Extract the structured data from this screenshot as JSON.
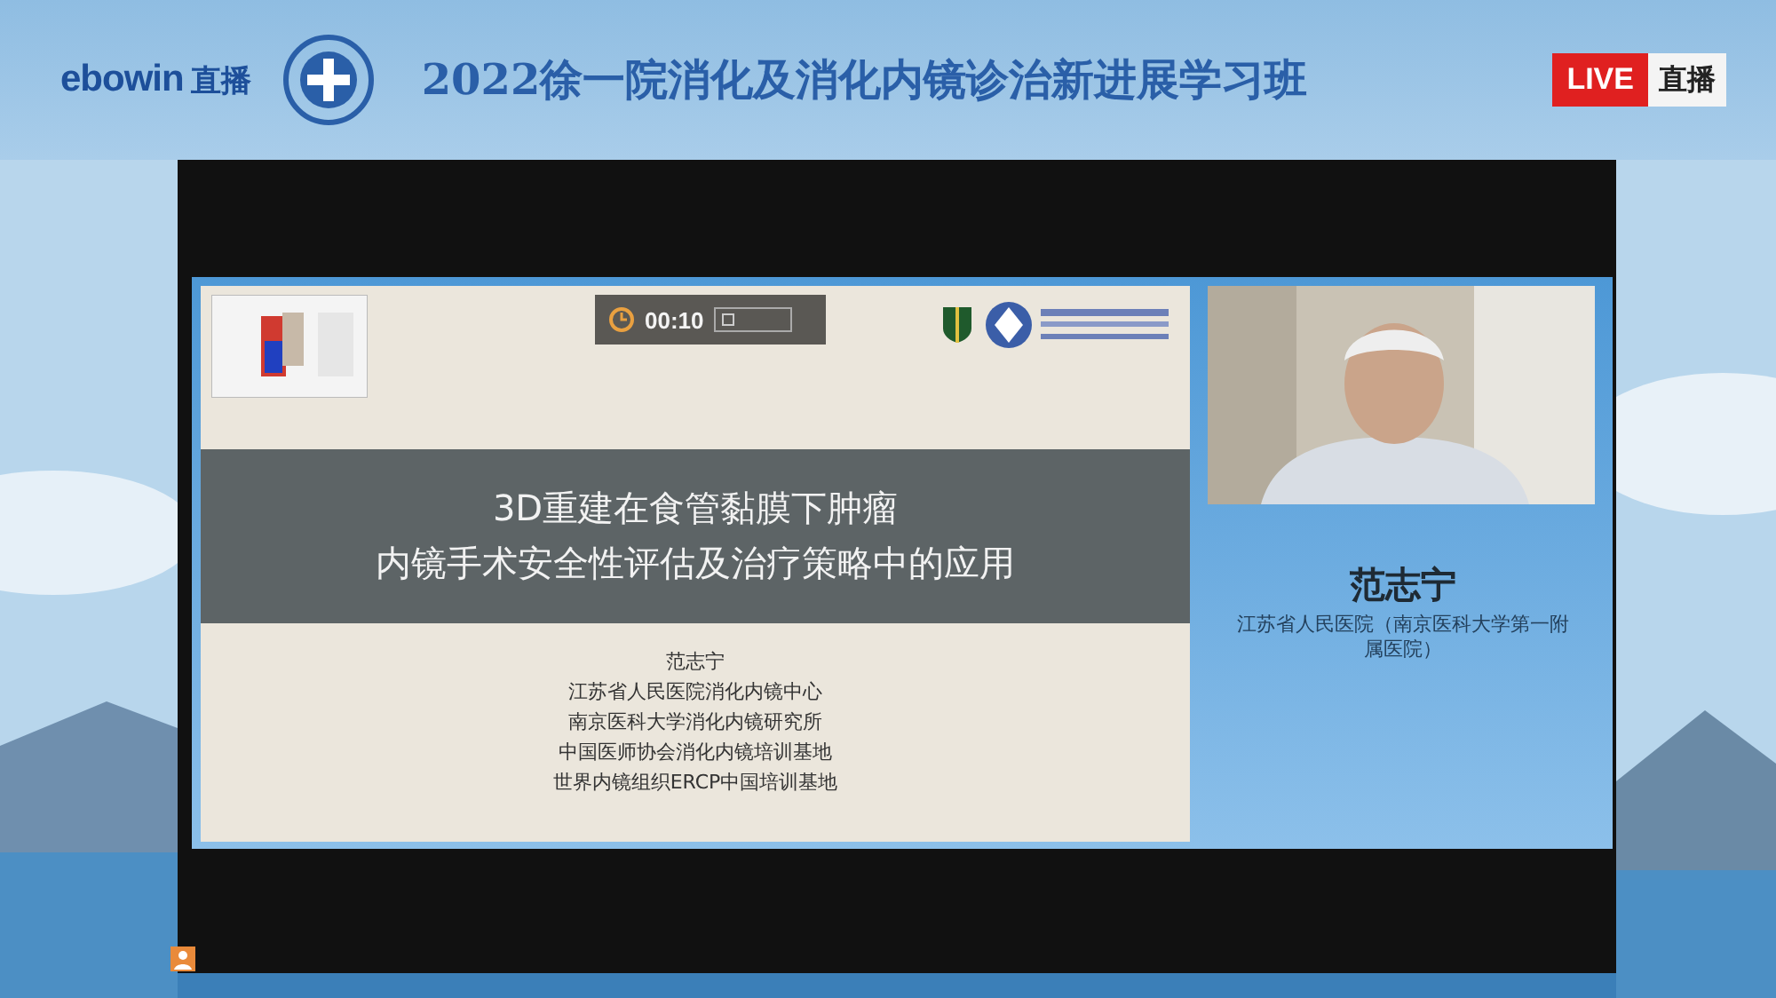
{
  "header": {
    "brand": "ebowin",
    "brand_suffix": "直播",
    "title": "2022徐一院消化及消化内镜诊治新进展学习班",
    "live_badge": "LIVE",
    "live_label": "直播"
  },
  "slide": {
    "timer": "00:10",
    "title_lines": [
      "3D重建在食管黏膜下肿瘤",
      "内镜手术安全性评估及治疗策略中的应用"
    ],
    "author_lines": [
      "范志宁",
      "江苏省人民医院消化内镜中心",
      "南京医科大学消化内镜研究所",
      "中国医师协会消化内镜培训基地",
      "世界内镜组织ERCP中国培训基地"
    ]
  },
  "speaker": {
    "name": "范志宁",
    "affiliation": "江苏省人民医院（南京医科大学第一附属医院）"
  }
}
